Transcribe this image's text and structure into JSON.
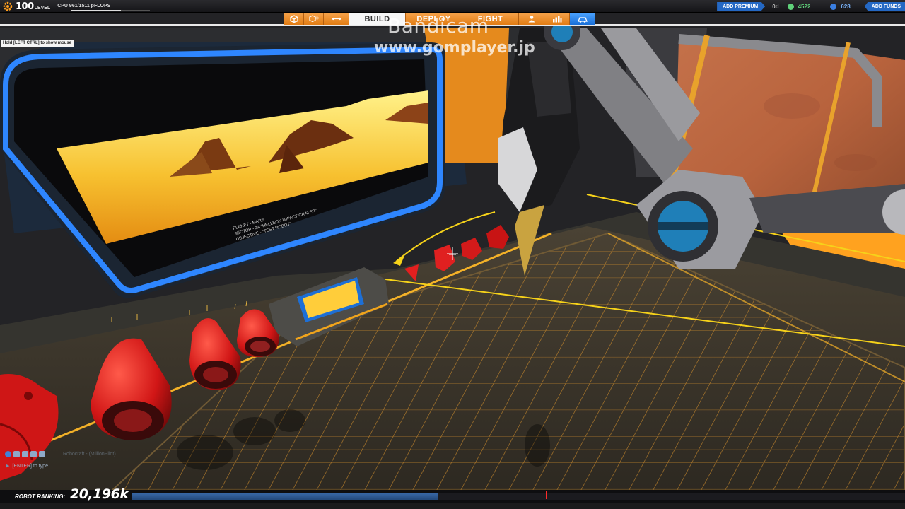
{
  "hud": {
    "level_number": "100",
    "level_word": "LEVEL",
    "cpu_text": "CPU 961/1511 pFLOPS",
    "cpu_fraction": 0.636,
    "nav_tabs": [
      "BUILD",
      "DEPLOY",
      "FIGHT"
    ],
    "active_tab": "BUILD",
    "premium_label": "ADD PREMIUM",
    "premium_days": "0d",
    "robits": "4522",
    "cosmetic_credits": "628",
    "funds_label": "ADD FUNDS"
  },
  "hint": {
    "text": "Hold [LEFT CTRL] to show mouse"
  },
  "watermark": {
    "line1": "Bandicam",
    "line2": "www.gomplayer.jp"
  },
  "screen_caption": {
    "line1": "PLANET - MARS",
    "line2": "SECTOR - 2A \"HELLEON IMPACT CRATER\"",
    "line3": "OBJECTIVE - \"TEST ROBOT\""
  },
  "chat": {
    "faded_text": "Robocraft - (MillionPilot)",
    "input_placeholder": "[ENTER] to type"
  },
  "ranking": {
    "label": "ROBOT RANKING:",
    "value": "20,196k",
    "progress_fraction": 0.395
  },
  "icons": {
    "level": "gear-icon",
    "nav": [
      "cube-icon",
      "cube-plus-icon",
      "connector-icon",
      "user-icon",
      "stats-icon",
      "garage-icon"
    ],
    "robits": "robit-coin-icon",
    "credits": "cc-coin-icon"
  },
  "colors": {
    "accent_orange": "#e8841d",
    "premium_blue": "#2468c4",
    "rank_fill": "#2f5c99",
    "robot_red": "#d81818"
  }
}
